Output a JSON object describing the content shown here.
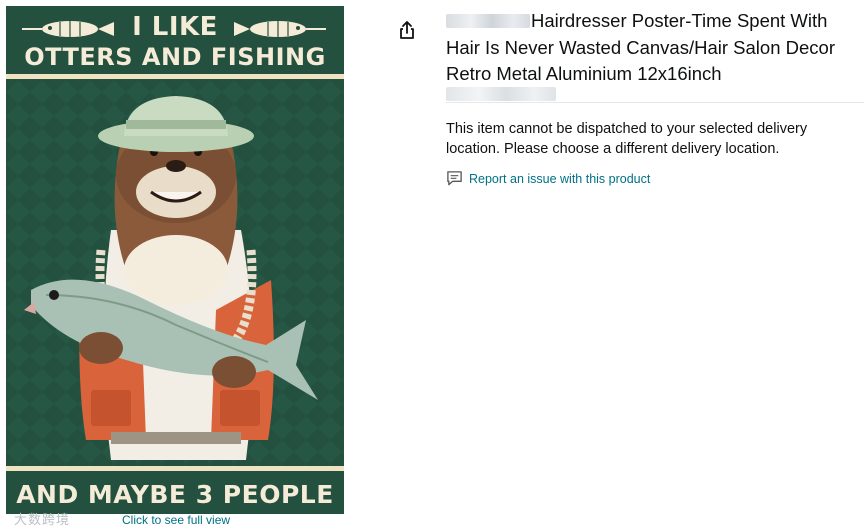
{
  "product": {
    "title": "Hairdresser Poster-Time Spent With Hair Is Never Wasted Canvas/Hair Salon Decor Retro Metal Aluminium 12x16inch",
    "poster": {
      "top_line1": "I LIKE",
      "top_line2": "OTTERS AND FISHING",
      "bottom_line": "AND MAYBE 3 PEOPLE"
    },
    "full_view_link": "Click to see full view",
    "watermark": "大数跨境"
  },
  "delivery": {
    "message": "This item cannot be dispatched to your selected delivery location. Please choose a different delivery location."
  },
  "report": {
    "label": "Report an issue with this product",
    "icon": "comment-icon"
  },
  "share": {
    "icon": "share-icon"
  },
  "colors": {
    "link": "#007185",
    "poster_bg": "#23503f",
    "poster_text": "#f4ecd6"
  }
}
